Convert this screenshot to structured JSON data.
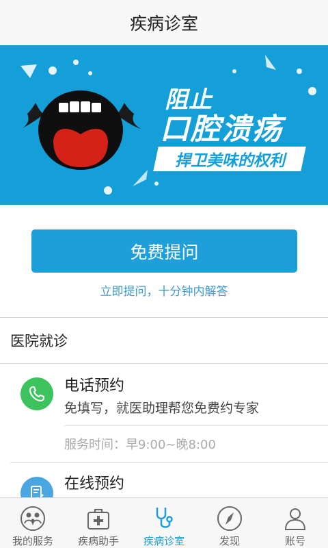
{
  "header": {
    "title": "疾病诊室"
  },
  "banner": {
    "line1": "阻止",
    "line2": "口腔溃疡",
    "line3": "捍卫美味的权利"
  },
  "ask": {
    "button_label": "免费提问",
    "subtext": "立即提问，十分钟内解答"
  },
  "hospital": {
    "section_title": "医院就诊",
    "services": [
      {
        "title": "电话预约",
        "desc": "免填写，就医助理帮您免费约专家",
        "time": "服务时间：早9:00~晚8:00",
        "icon": "phone-icon",
        "color": "#3cc35d"
      },
      {
        "title": "在线预约",
        "icon": "form-check-icon",
        "color": "#4aa6e0"
      }
    ]
  },
  "tabbar": {
    "items": [
      {
        "label": "我的服务",
        "icon": "family-icon",
        "active": false
      },
      {
        "label": "疾病助手",
        "icon": "medical-kit-icon",
        "active": false
      },
      {
        "label": "疾病诊室",
        "icon": "stethoscope-icon",
        "active": true
      },
      {
        "label": "发现",
        "icon": "compass-icon",
        "active": false
      },
      {
        "label": "账号",
        "icon": "user-icon",
        "active": false
      }
    ]
  },
  "colors": {
    "accent": "#1e9fd9",
    "banner_bg": "#149fd9",
    "phone_green": "#3cc35d"
  }
}
